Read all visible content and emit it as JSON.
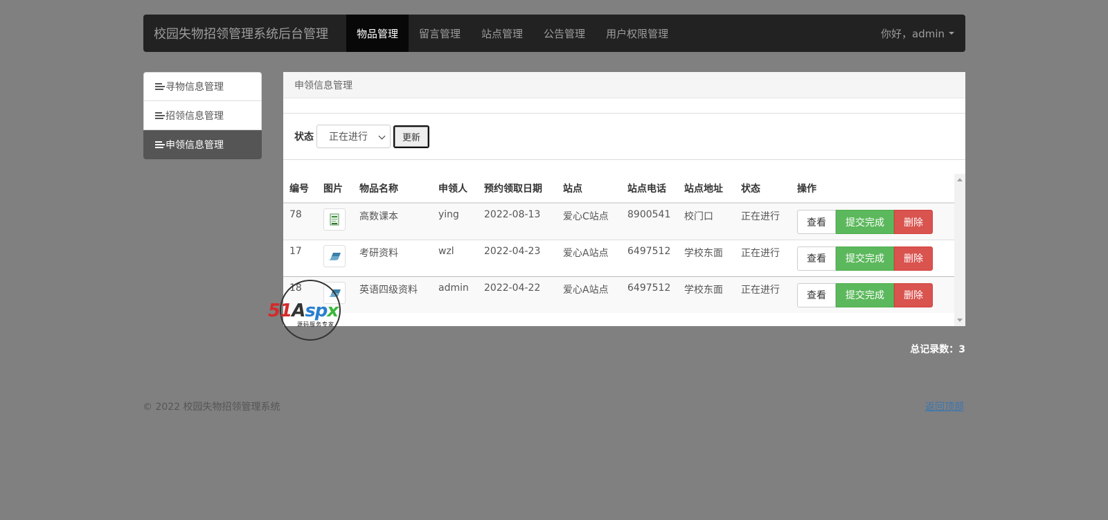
{
  "navbar": {
    "brand": "校园失物招领管理系统后台管理",
    "items": [
      {
        "label": "物品管理",
        "active": true
      },
      {
        "label": "留言管理",
        "active": false
      },
      {
        "label": "站点管理",
        "active": false
      },
      {
        "label": "公告管理",
        "active": false
      },
      {
        "label": "用户权限管理",
        "active": false
      }
    ],
    "user": "你好，admin"
  },
  "sidebar": {
    "items": [
      {
        "label": "寻物信息管理",
        "icon": "list-icon"
      },
      {
        "label": "招领信息管理",
        "icon": "list-icon"
      },
      {
        "label": "申领信息管理",
        "icon": "list-icon",
        "active": true
      }
    ]
  },
  "panel": {
    "title": "申领信息管理",
    "filter": {
      "label": "状态",
      "selected": "正在进行",
      "button": "更新"
    },
    "table": {
      "headers": [
        "编号",
        "图片",
        "物品名称",
        "申领人",
        "预约领取日期",
        "站点",
        "站点电话",
        "站点地址",
        "状态",
        "操作"
      ],
      "rows": [
        {
          "id": "78",
          "image": "book-thumbnail",
          "name": "高数课本",
          "claimant": "ying",
          "date": "2022-08-13",
          "station": "爱心C站点",
          "phone": "8900541",
          "address": "校门口",
          "status": "正在进行"
        },
        {
          "id": "17",
          "image": "eraser-thumbnail",
          "name": "考研资料",
          "claimant": "wzl",
          "date": "2022-04-23",
          "station": "爱心A站点",
          "phone": "6497512",
          "address": "学校东面",
          "status": "正在进行"
        },
        {
          "id": "18",
          "image": "eraser-thumbnail",
          "name": "英语四级资料",
          "claimant": "admin",
          "date": "2022-04-22",
          "station": "爱心A站点",
          "phone": "6497512",
          "address": "学校东面",
          "status": "正在进行"
        }
      ],
      "actions": {
        "view": "查看",
        "complete": "提交完成",
        "delete": "删除"
      }
    }
  },
  "total": {
    "label": "总记录数：",
    "value": "3"
  },
  "footer": {
    "copyright": "© 2022 校园失物招领管理系统",
    "back_to_top": "返回顶部"
  },
  "watermark": {
    "logo": "51Aspx",
    "logo_parts": [
      "51",
      "A",
      "sp",
      "x"
    ],
    "sub": "源码服务专家"
  },
  "colors": {
    "navbar": "#222222",
    "active_nav": "#080808",
    "success": "#5cb85c",
    "danger": "#d9534f",
    "sidebar_active": "#555555",
    "background": "#808080"
  }
}
